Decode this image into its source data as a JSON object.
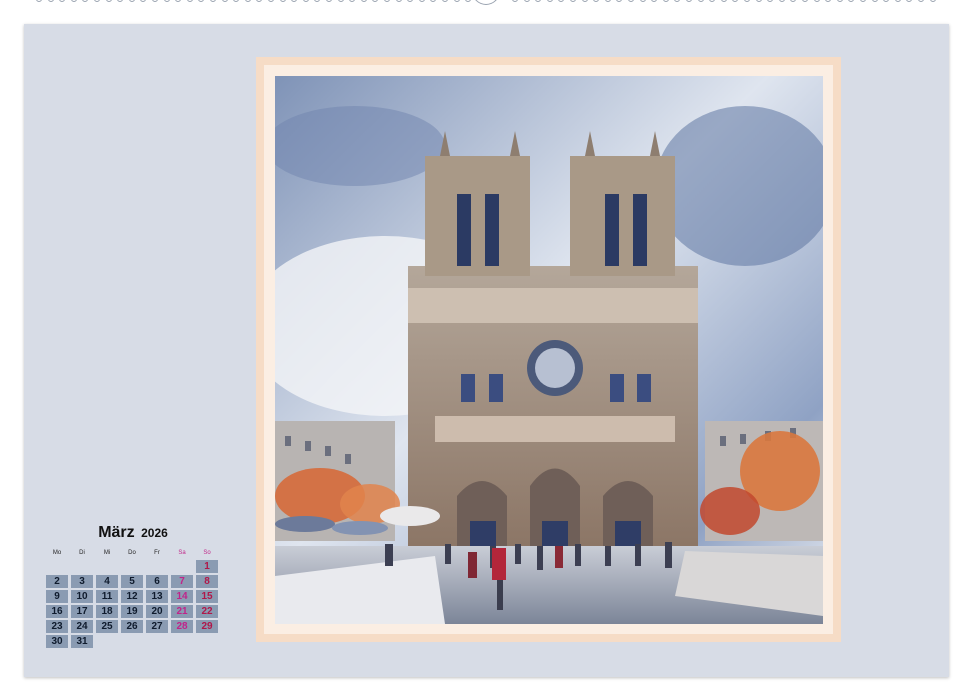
{
  "calendar": {
    "month": "März",
    "year": "2026",
    "weekdays": [
      "Mo",
      "Di",
      "Mi",
      "Do",
      "Fr",
      "Sa",
      "So"
    ],
    "weeks": [
      [
        "",
        "",
        "",
        "",
        "",
        "",
        "1"
      ],
      [
        "2",
        "3",
        "4",
        "5",
        "6",
        "7",
        "8"
      ],
      [
        "9",
        "10",
        "11",
        "12",
        "13",
        "14",
        "15"
      ],
      [
        "16",
        "17",
        "18",
        "19",
        "20",
        "21",
        "22"
      ],
      [
        "23",
        "24",
        "25",
        "26",
        "27",
        "28",
        "29"
      ],
      [
        "30",
        "31",
        "",
        "",
        "",
        "",
        ""
      ]
    ]
  },
  "colors": {
    "page": "#d7dce6",
    "frame": "#f6dcc6",
    "day_cell": "#8a9bb2",
    "weekend_text": "#c0248a"
  },
  "artwork": {
    "icon": "cathedral-illustration"
  }
}
